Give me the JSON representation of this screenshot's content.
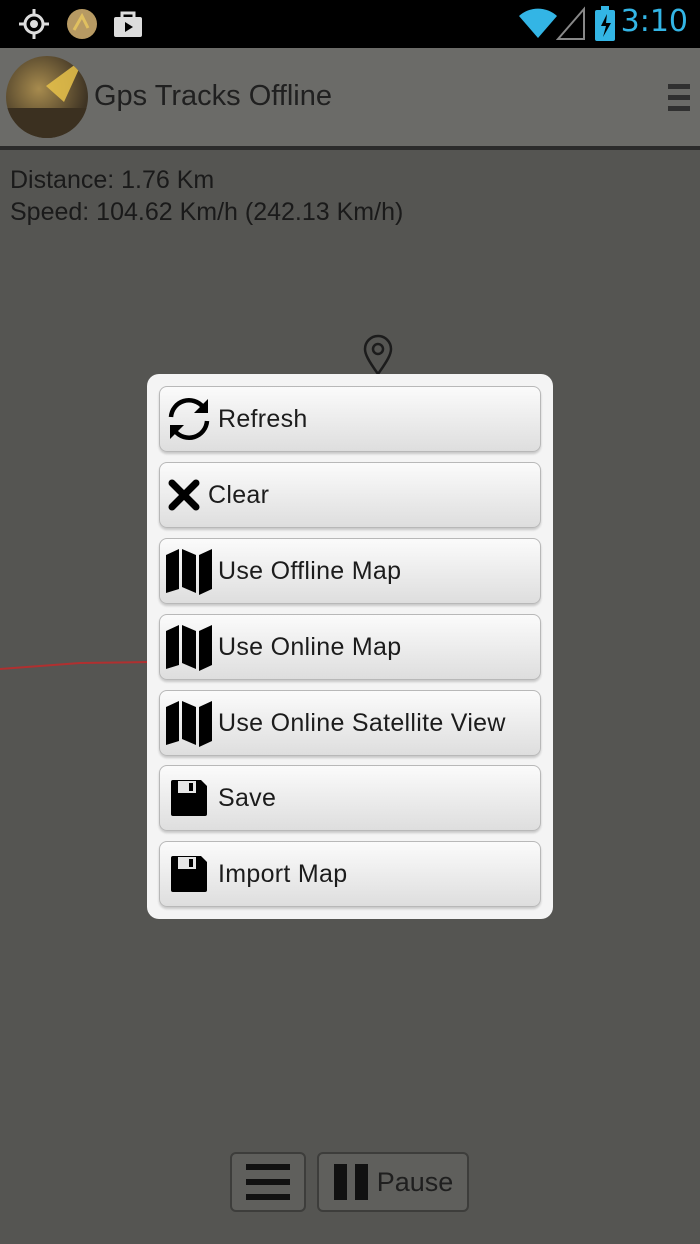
{
  "status_bar": {
    "time": "3:10",
    "icons": [
      "gps-icon",
      "notification-photo-icon",
      "play-store-icon",
      "wifi-icon",
      "signal-icon",
      "battery-charging-icon"
    ]
  },
  "action_bar": {
    "title": "Gps Tracks Offline",
    "logo": "app-logo"
  },
  "stats": {
    "distance": "Distance: 1.76 Km",
    "speed": "Speed: 104.62 Km/h (242.13 Km/h)"
  },
  "menu": {
    "items": [
      {
        "label": "Refresh",
        "icon": "refresh-icon"
      },
      {
        "label": "Clear",
        "icon": "close-x-icon"
      },
      {
        "label": "Use Offline Map",
        "icon": "map-icon"
      },
      {
        "label": "Use Online Map",
        "icon": "map-icon"
      },
      {
        "label": "Use Online Satellite View",
        "icon": "map-icon"
      },
      {
        "label": "Save",
        "icon": "floppy-disk-icon"
      },
      {
        "label": "Import Map",
        "icon": "floppy-disk-icon"
      }
    ]
  },
  "bottom": {
    "menu_icon": "hamburger-icon",
    "pause_label": "Pause"
  },
  "colors": {
    "clock": "#33b5e5",
    "track": "#b03030",
    "map_bg": "#555552"
  }
}
